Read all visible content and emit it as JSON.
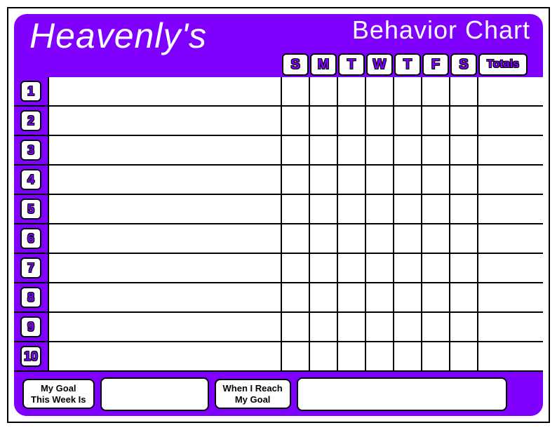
{
  "header": {
    "name": "Heavenly's",
    "title": "Behavior Chart"
  },
  "days": [
    "S",
    "M",
    "T",
    "W",
    "T",
    "F",
    "S"
  ],
  "totals_label": "Totals",
  "rows": [
    "1",
    "2",
    "3",
    "4",
    "5",
    "6",
    "7",
    "8",
    "9",
    "10"
  ],
  "footer": {
    "goal_label": "My Goal\nThis Week Is",
    "reach_label": "When I Reach\nMy Goal"
  }
}
